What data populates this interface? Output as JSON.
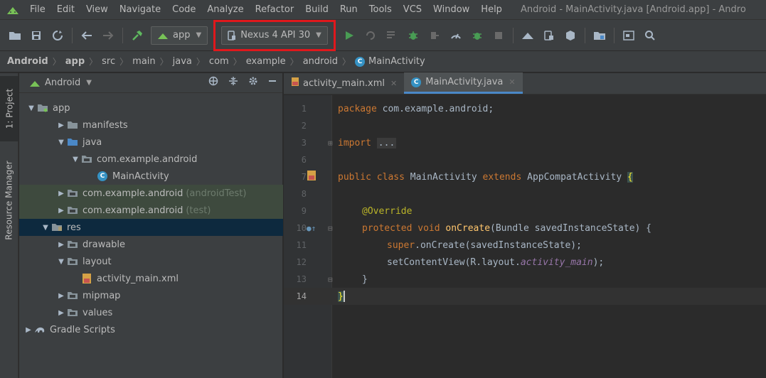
{
  "menu": {
    "items": [
      "File",
      "Edit",
      "View",
      "Navigate",
      "Code",
      "Analyze",
      "Refactor",
      "Build",
      "Run",
      "Tools",
      "VCS",
      "Window",
      "Help"
    ],
    "window_title": "Android - MainActivity.java [Android.app] - Andro"
  },
  "toolbar": {
    "run_config": "app",
    "device": "Nexus 4 API 30"
  },
  "breadcrumb": [
    "Android",
    "app",
    "src",
    "main",
    "java",
    "com",
    "example",
    "android",
    "MainActivity"
  ],
  "toolstrip": {
    "project_tab": "1: Project",
    "resource_tab": "Resource Manager"
  },
  "project": {
    "view_name": "Android",
    "tree": [
      {
        "label": "app",
        "suffix": ""
      },
      {
        "label": "manifests",
        "suffix": ""
      },
      {
        "label": "java",
        "suffix": ""
      },
      {
        "label": "com.example.android",
        "suffix": ""
      },
      {
        "label": "MainActivity",
        "suffix": ""
      },
      {
        "label": "com.example.android",
        "suffix": "(androidTest)"
      },
      {
        "label": "com.example.android",
        "suffix": "(test)"
      },
      {
        "label": "res",
        "suffix": ""
      },
      {
        "label": "drawable",
        "suffix": ""
      },
      {
        "label": "layout",
        "suffix": ""
      },
      {
        "label": "activity_main.xml",
        "suffix": ""
      },
      {
        "label": "mipmap",
        "suffix": ""
      },
      {
        "label": "values",
        "suffix": ""
      },
      {
        "label": "Gradle Scripts",
        "suffix": ""
      }
    ]
  },
  "editor": {
    "tabs": [
      "activity_main.xml",
      "MainActivity.java"
    ],
    "active_tab": "MainActivity.java",
    "line_numbers": [
      "1",
      "2",
      "3",
      "6",
      "7",
      "8",
      "9",
      "10",
      "11",
      "12",
      "13",
      "14"
    ],
    "code": {
      "package_kw": "package",
      "package_name": "com.example.android;",
      "import_kw": "import",
      "import_fold": "...",
      "class_decl_public": "public class",
      "class_name": "MainActivity",
      "extends_kw": "extends",
      "super_class": "AppCompatActivity",
      "open_brace": "{",
      "override": "@Override",
      "method_mods": "protected void",
      "method_name": "onCreate",
      "method_params": "(Bundle savedInstanceState) {",
      "super_call_kw": "super",
      "super_call_rest": ".onCreate(savedInstanceState);",
      "set_content": "setContentView(R.layout.",
      "layout_field": "activity_main",
      "set_content_end": ");",
      "close_method": "}",
      "close_class": "}"
    }
  },
  "colors": {
    "highlight_box": "#e0181c",
    "keyword": "#cc7832",
    "annotation": "#bbb529",
    "function": "#ffc66d",
    "active_tab_underline": "#4a88c7"
  }
}
